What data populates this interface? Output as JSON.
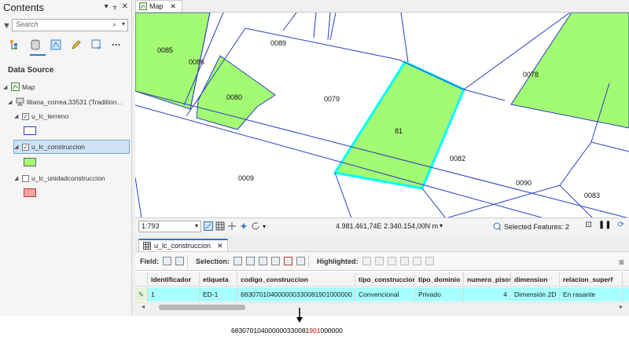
{
  "contents": {
    "title": "Contents",
    "search_placeholder": "Search",
    "section_title": "Data Source",
    "map_item": "Map",
    "db_item": "liliana_correa.33531 (Tradition...",
    "layers": [
      {
        "name": "u_lc_terreno",
        "checked": true,
        "swatch": "outline-blue"
      },
      {
        "name": "u_lc_construccion",
        "checked": true,
        "swatch": "fill-green",
        "selected": true
      },
      {
        "name": "u_lc_unidadconstruccion",
        "checked": false,
        "swatch": "fill-pink"
      }
    ],
    "view_icons": [
      "list-by-drawing-order-icon",
      "list-by-source-icon",
      "list-by-selection-icon",
      "list-by-editing-icon",
      "list-by-snapping-icon",
      "more-icon"
    ]
  },
  "map": {
    "tab_label": "Map",
    "parcel_labels": [
      "0085",
      "0086",
      "0089",
      "0080",
      "0079",
      "81",
      "0078",
      "0082",
      "0009",
      "0090",
      "0083"
    ],
    "colors": {
      "parcel_fill": "#a3fa73",
      "boundary": "#2b3fbf",
      "selection": "#00ffff"
    }
  },
  "status_bar": {
    "scale": "1:793",
    "coordinates": "4.981.461,74E 2.340.154,00N m",
    "selected_features": "Selected Features: 2"
  },
  "table": {
    "tab_label": "u_lc_construccion",
    "toolbar": {
      "field_label": "Field:",
      "selection_label": "Selection:",
      "highlighted_label": "Highlighted:"
    },
    "columns": [
      "identificador",
      "etiqueta",
      "codigo_construccion",
      "tipo_construccion",
      "tipo_dominio",
      "numero_pisos",
      "dimension",
      "relacion_superf"
    ],
    "rows": [
      [
        "1",
        "ED-1",
        "683070104000000330081901000000",
        "Convencional",
        "Privado",
        "4",
        "Dimensión 2D",
        "En rasante"
      ]
    ]
  },
  "annotation": {
    "code_prefix": "683070104000000330081",
    "code_highlight": "901",
    "code_suffix": "000000"
  }
}
